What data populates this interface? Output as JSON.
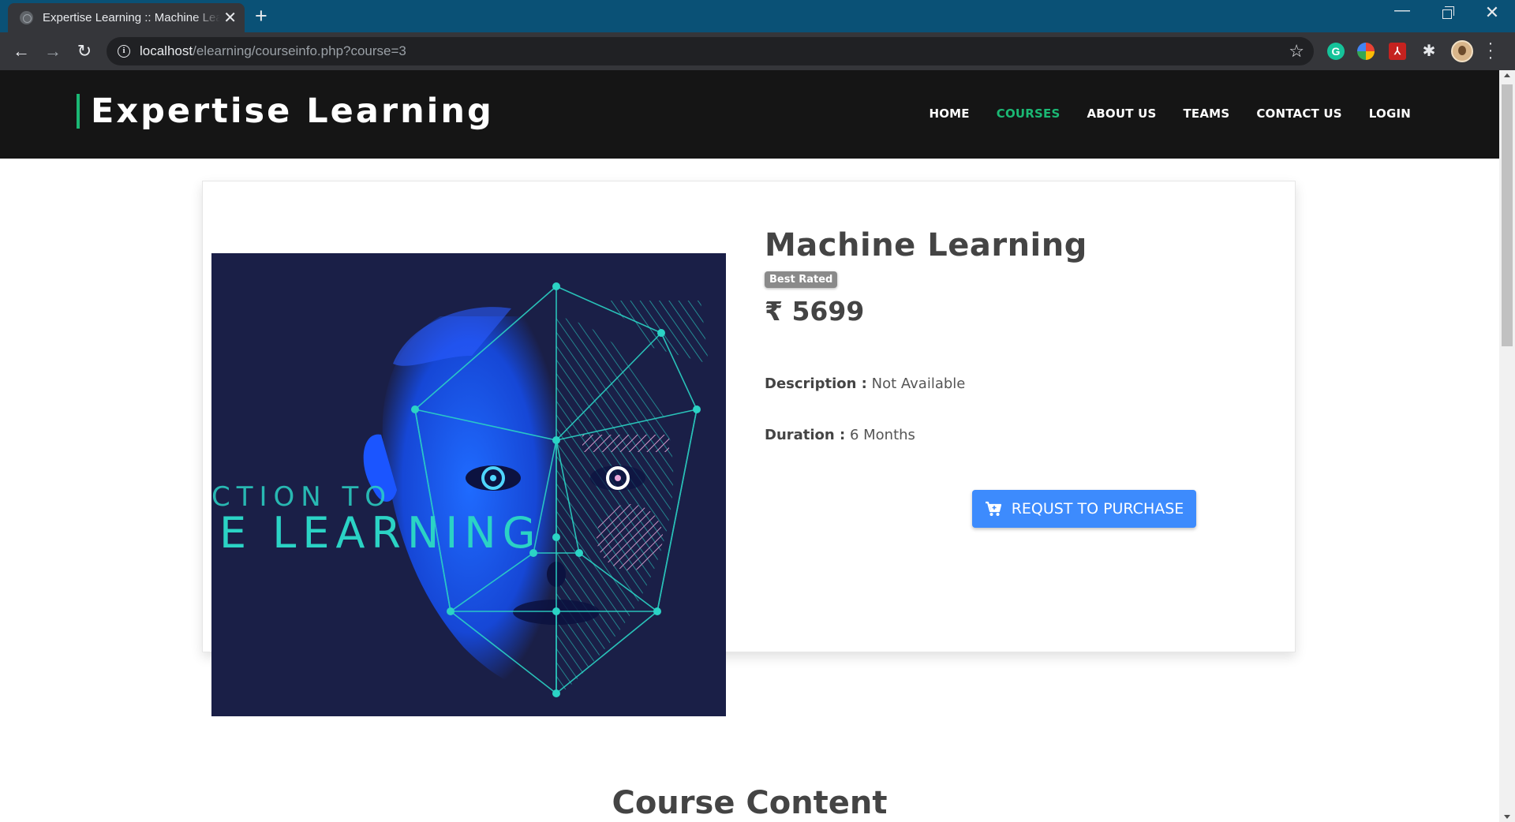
{
  "browser": {
    "tab_title": "Expertise Learning :: Machine Learning",
    "url_host": "localhost",
    "url_path": "/elearning/courseinfo.php?course=3"
  },
  "site": {
    "brand": "Expertise Learning",
    "nav": [
      "HOME",
      "COURSES",
      "ABOUT US",
      "TEAMS",
      "CONTACT US",
      "LOGIN"
    ],
    "active_nav": "COURSES",
    "accent_color": "#1bb874"
  },
  "course": {
    "title": "Machine Learning",
    "badge": "Best Rated",
    "price": "₹ 5699",
    "description_label": "Description :",
    "description_value": "Not Available",
    "duration_label": "Duration :",
    "duration_value": "6 Months",
    "purchase_label": "REQUST TO PURCHASE",
    "image_text_line1": "CTION TO",
    "image_text_line2": "E LEARNING"
  },
  "section": {
    "course_content_title": "Course Content"
  },
  "icons": [
    "info-icon",
    "star-icon",
    "cart-icon",
    "back-arrow-icon",
    "forward-arrow-icon",
    "reload-icon"
  ]
}
